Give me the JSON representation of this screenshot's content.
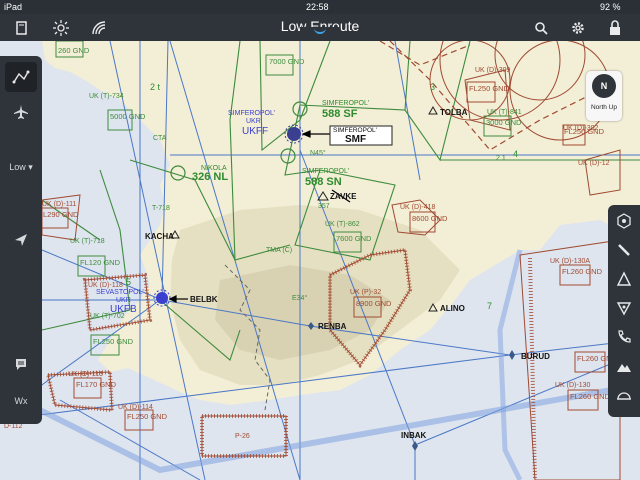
{
  "status_bar": {
    "carrier": "iPad",
    "time": "22:58",
    "battery": "92 %"
  },
  "top_bar": {
    "title": "Low Enroute",
    "icons": [
      "documents-icon",
      "brightness-icon",
      "signal-icon",
      "search-icon",
      "settings-icon",
      "lock-icon"
    ]
  },
  "left_toolbar": {
    "layer_label": "Low ▾",
    "wx_label": "Wx"
  },
  "compass": {
    "label": "N",
    "text": "North Up"
  },
  "map": {
    "places": [
      "KACHA",
      "BELBK",
      "RENBA",
      "ALINO",
      "BURUD",
      "INBAK",
      "ZAVKE",
      "TOLBA"
    ],
    "airport_labels": [
      "SIMFEROPOL'",
      "UKR",
      "UKFF",
      "SEVASTOPOL'",
      "UKR",
      "UKFB"
    ],
    "vor_boxes": [
      {
        "name": "SIMFEROPOL'",
        "freq": "588 SF"
      },
      {
        "name": "SIMFEROPOL'",
        "freq": "588 SN"
      },
      {
        "name": "NIKOLA",
        "freq": "326 NL"
      },
      {
        "name": "SIMFEROPOL'",
        "ident": "SMF"
      }
    ],
    "airspace_labels": [
      "UK (T)-734",
      "UK (T)-718",
      "UK (T)-862",
      "UK (T)-702",
      "UK (D)-111",
      "UK (D)-118",
      "UK (D)-113",
      "UK (D)-114",
      "UK (D)-418",
      "UK (P)-32",
      "UK (D)-130A",
      "UK (D)-130",
      "UK (D)-302",
      "UK (D)-12",
      "UK (T)-841",
      "UK (D)-309",
      "D-112",
      "T-718",
      "P-26",
      "N45°",
      "E34°",
      "TMA (C)",
      "CTA"
    ],
    "altitude_blocks": [
      "7000 GND",
      "5000 GND",
      "260 GND",
      "L290 GND",
      "FL250 GND",
      "FL170 GND",
      "FL250 GND",
      "FL120 GND",
      "7600 GND",
      "8600 GND",
      "8900 GND",
      "FL260 GND",
      "FL260 GND",
      "FL260 GND",
      "FL250 GND",
      "3000 GND",
      "FL250 GND"
    ],
    "misc": [
      "2 t",
      "3",
      "5",
      "7",
      "4",
      "2 1",
      "357"
    ]
  },
  "colors": {
    "bar": "#2f343a",
    "water": "#dfe5ee",
    "land": "#f3eed6",
    "airway": "#3d8b3d",
    "route_blue": "#4a78c8",
    "restricted": "#a04a32",
    "accent": "#3ba3e6"
  }
}
